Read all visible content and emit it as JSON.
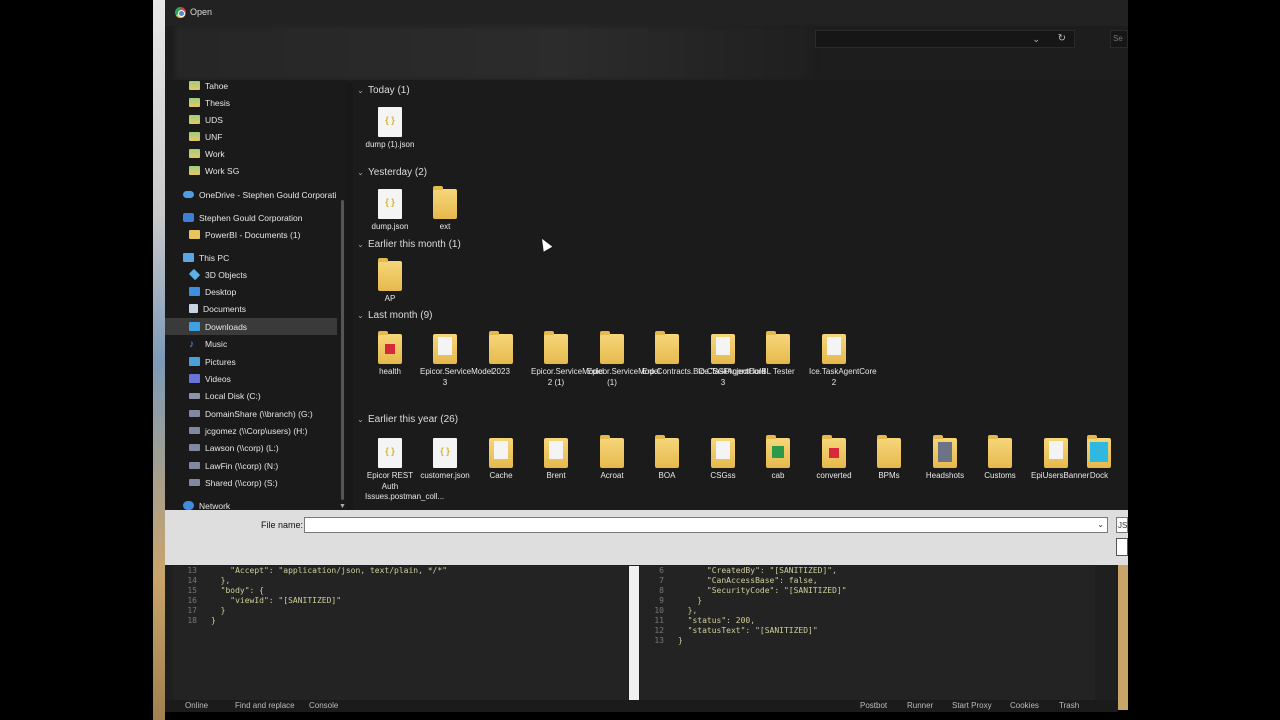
{
  "window": {
    "title": "Open"
  },
  "navbar": {
    "search_placeholder": "Se"
  },
  "sidebar": {
    "items": [
      {
        "label": "Tahoe",
        "icon": "folder-green-icon"
      },
      {
        "label": "Thesis",
        "icon": "folder-green-icon"
      },
      {
        "label": "UDS",
        "icon": "folder-green-icon"
      },
      {
        "label": "UNF",
        "icon": "folder-green-icon"
      },
      {
        "label": "Work",
        "icon": "folder-green-icon"
      },
      {
        "label": "Work SG",
        "icon": "folder-green-icon"
      },
      {
        "label": "OneDrive - Stephen Gould Corporati",
        "icon": "onedrive-icon"
      },
      {
        "label": "Stephen Gould Corporation",
        "icon": "sharepoint-icon"
      },
      {
        "label": "PowerBI - Documents (1)",
        "icon": "folder-icon"
      },
      {
        "label": "This PC",
        "icon": "pc-icon"
      },
      {
        "label": "3D Objects",
        "icon": "3d-objects-icon"
      },
      {
        "label": "Desktop",
        "icon": "desktop-icon"
      },
      {
        "label": "Documents",
        "icon": "documents-icon"
      },
      {
        "label": "Downloads",
        "icon": "downloads-icon"
      },
      {
        "label": "Music",
        "icon": "music-icon"
      },
      {
        "label": "Pictures",
        "icon": "pictures-icon"
      },
      {
        "label": "Videos",
        "icon": "videos-icon"
      },
      {
        "label": "Local Disk (C:)",
        "icon": "disk-icon"
      },
      {
        "label": "DomainShare (\\\\branch) (G:)",
        "icon": "network-drive-icon"
      },
      {
        "label": "jcgomez (\\\\Corp\\users) (H:)",
        "icon": "network-drive-icon"
      },
      {
        "label": "Lawson (\\\\corp) (L:)",
        "icon": "network-drive-icon"
      },
      {
        "label": "LawFin (\\\\corp) (N:)",
        "icon": "network-drive-icon"
      },
      {
        "label": "Shared (\\\\corp) (S:)",
        "icon": "network-drive-icon"
      },
      {
        "label": "Network",
        "icon": "network-icon"
      }
    ],
    "selected": "Downloads"
  },
  "groups": {
    "today": {
      "label": "Today (1)",
      "files": [
        {
          "name": "dump (1).json",
          "icon": "json-file-icon"
        }
      ]
    },
    "yesterday": {
      "label": "Yesterday (2)",
      "files": [
        {
          "name": "dump.json",
          "icon": "json-file-icon"
        },
        {
          "name": "ext",
          "icon": "folder-icon"
        }
      ]
    },
    "earlier_month": {
      "label": "Earlier this month (1)",
      "files": [
        {
          "name": "AP",
          "icon": "folder-icon"
        }
      ]
    },
    "last_month": {
      "label": "Last month (9)",
      "files": [
        {
          "name": "health",
          "icon": "folder-icon"
        },
        {
          "name": "Epicor.ServiceModel 3",
          "icon": "folder-icon"
        },
        {
          "name": "2023",
          "icon": "folder-icon"
        },
        {
          "name": "Epicor.ServiceModel 2 (1)",
          "icon": "folder-icon"
        },
        {
          "name": "Epicor.ServiceModel (1)",
          "icon": "folder-icon"
        },
        {
          "name": "Erp.Contracts.BO.CSGProjectHold",
          "icon": "folder-icon"
        },
        {
          "name": "Ice.TaskAgentCore 3",
          "icon": "folder-icon"
        },
        {
          "name": "BL Tester",
          "icon": "folder-icon"
        },
        {
          "name": "Ice.TaskAgentCore 2",
          "icon": "folder-icon"
        }
      ]
    },
    "earlier_year": {
      "label": "Earlier this year (26)",
      "files": [
        {
          "name": "Epicor REST Auth Issues.postman_coll...",
          "icon": "json-file-icon"
        },
        {
          "name": "customer.json",
          "icon": "json-file-icon"
        },
        {
          "name": "Cache",
          "icon": "folder-icon"
        },
        {
          "name": "Brent",
          "icon": "folder-icon"
        },
        {
          "name": "Acroat",
          "icon": "folder-icon"
        },
        {
          "name": "BOA",
          "icon": "folder-icon"
        },
        {
          "name": "CSGss",
          "icon": "folder-icon"
        },
        {
          "name": "cab",
          "icon": "folder-icon"
        },
        {
          "name": "converted",
          "icon": "folder-icon"
        },
        {
          "name": "BPMs",
          "icon": "folder-icon"
        },
        {
          "name": "Headshots",
          "icon": "folder-icon"
        },
        {
          "name": "Customs",
          "icon": "folder-icon"
        },
        {
          "name": "EpiUsersBanner",
          "icon": "folder-icon"
        },
        {
          "name": "Dock",
          "icon": "folder-icon"
        }
      ]
    }
  },
  "bottom": {
    "file_name_label": "File name:",
    "file_name_value": "",
    "file_type": "JS"
  },
  "editor": {
    "left_lines": [
      {
        "n": "13",
        "t": "    \"Accept\": \"application/json, text/plain, */*\""
      },
      {
        "n": "14",
        "t": "  },"
      },
      {
        "n": "15",
        "t": "  \"body\": {"
      },
      {
        "n": "16",
        "t": "    \"viewId\": \"[SANITIZED]\""
      },
      {
        "n": "17",
        "t": "  }"
      },
      {
        "n": "18",
        "t": "}"
      }
    ],
    "right_lines": [
      {
        "n": "6",
        "t": "      \"CreatedBy\": \"[SANITIZED]\","
      },
      {
        "n": "7",
        "t": "      \"CanAccessBase\": false,"
      },
      {
        "n": "8",
        "t": "      \"SecurityCode\": \"[SANITIZED]\""
      },
      {
        "n": "9",
        "t": "    }"
      },
      {
        "n": "10",
        "t": "  },"
      },
      {
        "n": "11",
        "t": "  \"status\": 200,"
      },
      {
        "n": "12",
        "t": "  \"statusText\": \"[SANITIZED]\""
      },
      {
        "n": "13",
        "t": "}"
      }
    ]
  },
  "statusbar": {
    "left": [
      "Online",
      "Find and replace",
      "Console"
    ],
    "right": [
      "Postbot",
      "Runner",
      "Start Proxy",
      "Cookies",
      "Trash"
    ]
  }
}
